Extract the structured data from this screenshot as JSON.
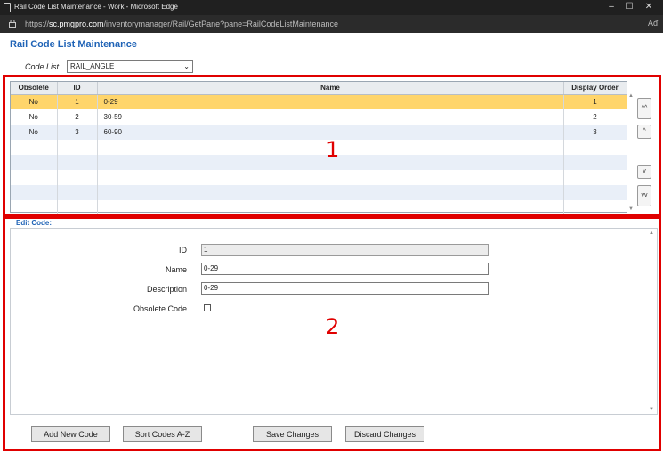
{
  "window": {
    "title": "Rail Code List Maintenance - Work - Microsoft Edge",
    "url_prefix": "https://",
    "url_host": "sc.pmgpro.com",
    "url_path": "/inventorymanager/Rail/GetPane?pane=RailCodeListMaintenance",
    "read_aloud": "Aᵭ"
  },
  "page": {
    "title": "Rail Code List Maintenance",
    "code_list_label": "Code List",
    "code_list_value": "RAIL_ANGLE"
  },
  "grid": {
    "headers": [
      "Obsolete",
      "ID",
      "Name",
      "Display Order"
    ],
    "rows": [
      {
        "obsolete": "No",
        "id": "1",
        "name": "0-29",
        "order": "1"
      },
      {
        "obsolete": "No",
        "id": "2",
        "name": "30-59",
        "order": "2"
      },
      {
        "obsolete": "No",
        "id": "3",
        "name": "60-90",
        "order": "3"
      }
    ],
    "move_buttons": [
      "^^",
      "^",
      "v",
      "vv"
    ]
  },
  "edit": {
    "section_label": "Edit Code:",
    "id_label": "ID",
    "id_value": "1",
    "name_label": "Name",
    "name_value": "0-29",
    "description_label": "Description",
    "description_value": "0-29",
    "obsolete_label": "Obsolete Code"
  },
  "buttons": {
    "add": "Add New Code",
    "sort": "Sort Codes A-Z",
    "save": "Save Changes",
    "discard": "Discard Changes"
  },
  "callouts": [
    "1",
    "2"
  ],
  "colors": {
    "accent": "#1f63b6",
    "selected_row": "#ffd56b",
    "highlight_box": "#e00000"
  }
}
